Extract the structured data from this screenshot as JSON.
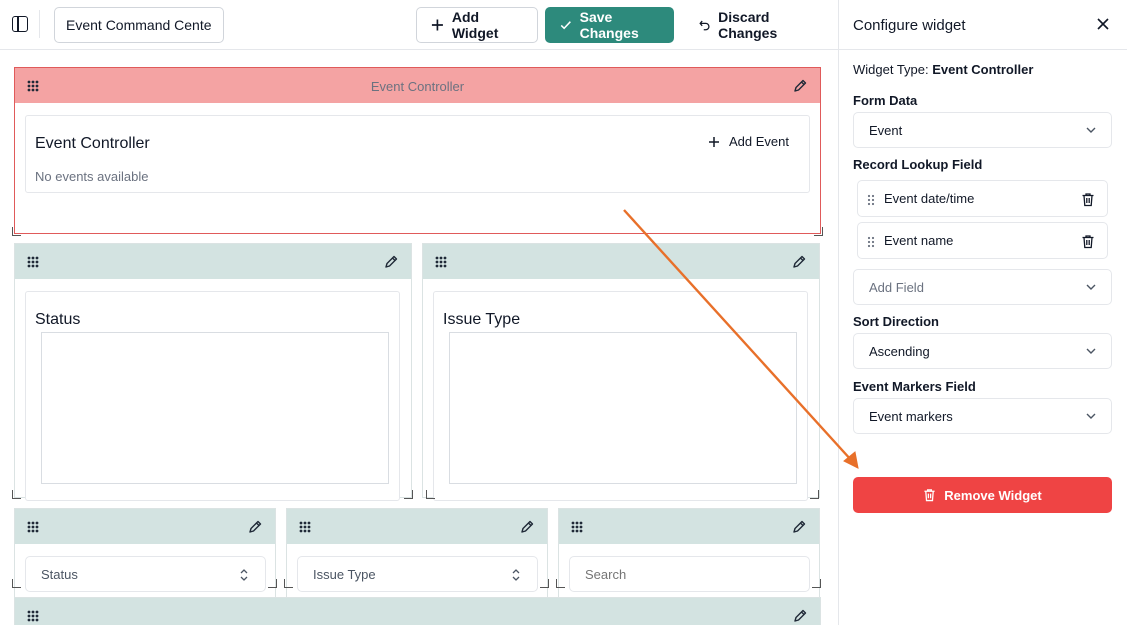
{
  "toolbar": {
    "dashboard_name": "Event Command Center",
    "add_widget_label": "Add Widget",
    "save_label": "Save Changes",
    "discard_label": "Discard Changes"
  },
  "canvas": {
    "event_controller_widget": {
      "header_title": "Event Controller",
      "card_title": "Event Controller",
      "add_event_label": "Add Event",
      "empty_text": "No events available"
    },
    "status_chart": {
      "title": "Status"
    },
    "issue_type_chart": {
      "title": "Issue Type"
    },
    "status_filter": {
      "value": "Status"
    },
    "issue_type_filter": {
      "value": "Issue Type"
    },
    "search_filter": {
      "placeholder": "Search"
    }
  },
  "panel": {
    "title": "Configure widget",
    "widget_type_label": "Widget Type:",
    "widget_type_value": "Event Controller",
    "form_data_label": "Form Data",
    "form_data_value": "Event",
    "record_lookup_label": "Record Lookup Field",
    "lookup_fields": [
      {
        "label": "Event date/time"
      },
      {
        "label": "Event name"
      }
    ],
    "add_field_placeholder": "Add Field",
    "sort_direction_label": "Sort Direction",
    "sort_direction_value": "Ascending",
    "event_markers_label": "Event Markers Field",
    "event_markers_value": "Event markers",
    "remove_label": "Remove Widget"
  },
  "colors": {
    "accent": "#2d8a7c",
    "danger": "#ef4444",
    "selected_header": "#f4a3a3",
    "widget_header": "#d3e3e1",
    "annotation_arrow": "#e8702a"
  },
  "icons": [
    "sidebar-toggle-icon",
    "plus-icon",
    "check-icon",
    "undo-icon",
    "drag-handle-icon",
    "pencil-icon",
    "close-icon",
    "chevron-down-icon",
    "trash-icon",
    "grip-icon",
    "up-down-icon"
  ]
}
